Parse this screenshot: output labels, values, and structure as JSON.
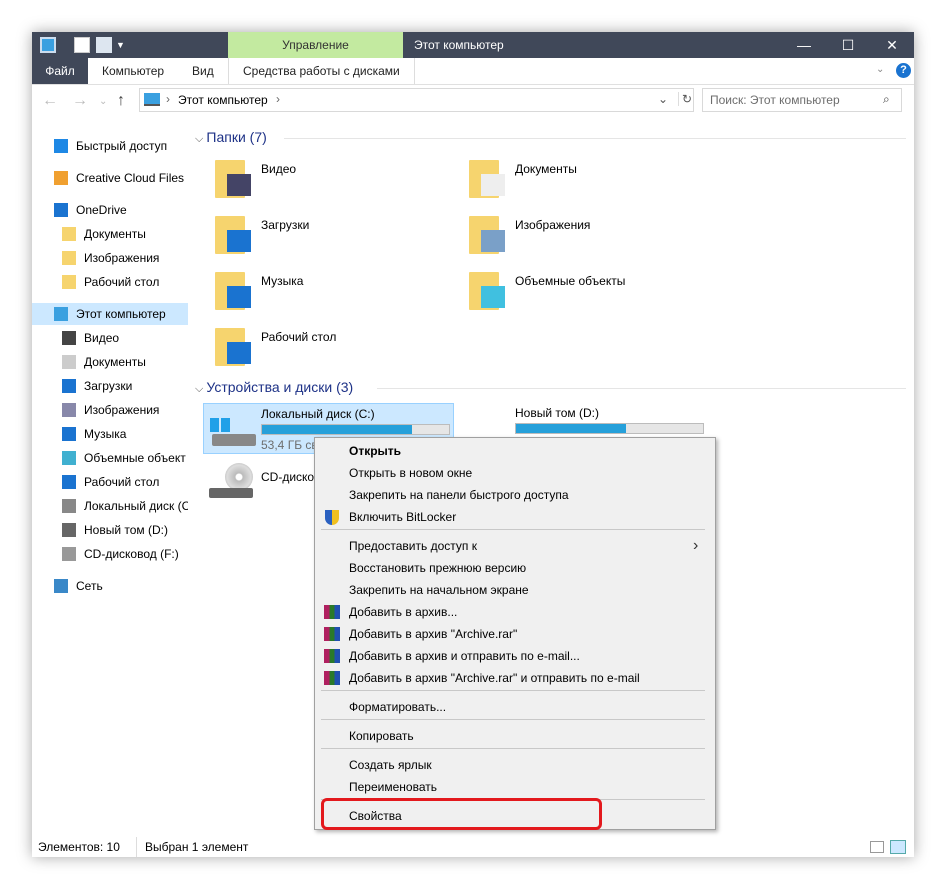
{
  "titlebar": {
    "manage_tab": "Управление",
    "title": "Этот компьютер",
    "minimize": "—",
    "maximize": "☐",
    "close": "✕"
  },
  "ribbon": {
    "tabs": [
      "Файл",
      "Компьютер",
      "Вид",
      "Средства работы с дисками"
    ],
    "help": "?"
  },
  "address": {
    "path": "Этот компьютер",
    "search_placeholder": "Поиск: Этот компьютер"
  },
  "sidebar": {
    "items": [
      "Быстрый доступ",
      "Creative Cloud Files",
      "OneDrive",
      "Документы",
      "Изображения",
      "Рабочий стол",
      "Этот компьютер",
      "Видео",
      "Документы",
      "Загрузки",
      "Изображения",
      "Музыка",
      "Объемные объект",
      "Рабочий стол",
      "Локальный диск (С",
      "Новый том (D:)",
      "CD-дисковод (F:)",
      "Сеть"
    ]
  },
  "folders": {
    "header": "Папки (7)",
    "items": [
      "Видео",
      "Документы",
      "Загрузки",
      "Изображения",
      "Музыка",
      "Объемные объекты",
      "Рабочий стол"
    ]
  },
  "drives": {
    "header": "Устройства и диски (3)",
    "items": [
      {
        "name": "Локальный диск (C:)",
        "free": "53,4 ГБ св",
        "used_fraction": 0.8
      },
      {
        "name": "Новый том (D:)",
        "used_fraction": 0.59
      },
      {
        "name": "CD-диско"
      }
    ]
  },
  "context_menu": {
    "items": [
      "Открыть",
      "Открыть в новом окне",
      "Закрепить на панели быстрого доступа",
      "Включить BitLocker",
      "Предоставить доступ к",
      "Восстановить прежнюю версию",
      "Закрепить на начальном экране",
      "Добавить в архив...",
      "Добавить в архив \"Archive.rar\"",
      "Добавить в архив и отправить по e-mail...",
      "Добавить в архив \"Archive.rar\" и отправить по e-mail",
      "Форматировать...",
      "Копировать",
      "Создать ярлык",
      "Переименовать",
      "Свойства"
    ]
  },
  "status": {
    "count": "Элементов: 10",
    "selected": "Выбран 1 элемент"
  },
  "colors": {
    "titlebar": "#404859",
    "manage": "#c3eaa0",
    "selection": "#cce8ff",
    "progress": "#26a0da",
    "highlight": "#e3191d"
  }
}
